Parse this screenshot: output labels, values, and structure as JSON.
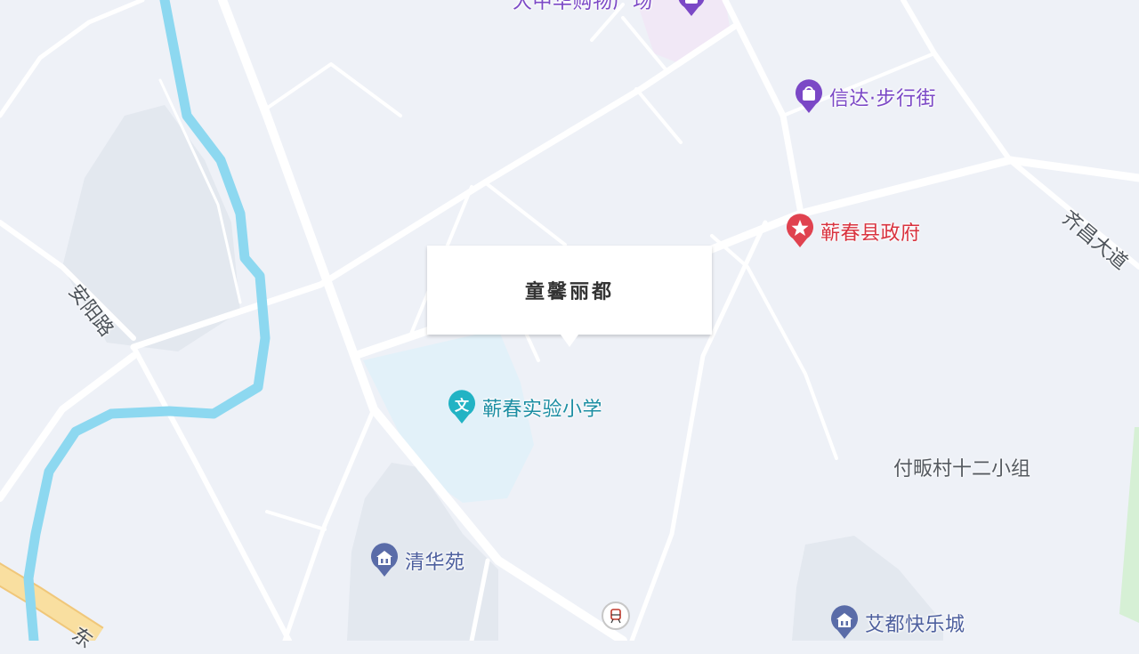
{
  "map": {
    "popup": {
      "title": "童馨丽都"
    },
    "pois": [
      {
        "name": "大中华购物广场",
        "color": "#7b48c6",
        "icon": "shopping-bag-icon"
      },
      {
        "name": "信达·步行街",
        "color": "#7b48c6",
        "icon": "shopping-bag-icon"
      },
      {
        "name": "蕲春县政府",
        "color": "#d9333f",
        "icon": "government-star-icon"
      },
      {
        "name": "蕲春实验小学",
        "color": "#1c8ea3",
        "icon": "school-icon"
      },
      {
        "name": "清华苑",
        "color": "#4d5f9e",
        "icon": "residential-icon"
      },
      {
        "name": "艾都快乐城",
        "color": "#4d5f9e",
        "icon": "residential-icon"
      }
    ],
    "places": [
      "付畈村十二小组"
    ],
    "roads": [
      "安阳路",
      "齐昌大道",
      "东"
    ],
    "colors": {
      "background": "#eef1f7",
      "road": "#ffffff",
      "river": "#8dd8f0",
      "highway": "#f9dfa0",
      "school_area": "#e2f1f9",
      "residential_block": "#e3e8ef"
    }
  }
}
